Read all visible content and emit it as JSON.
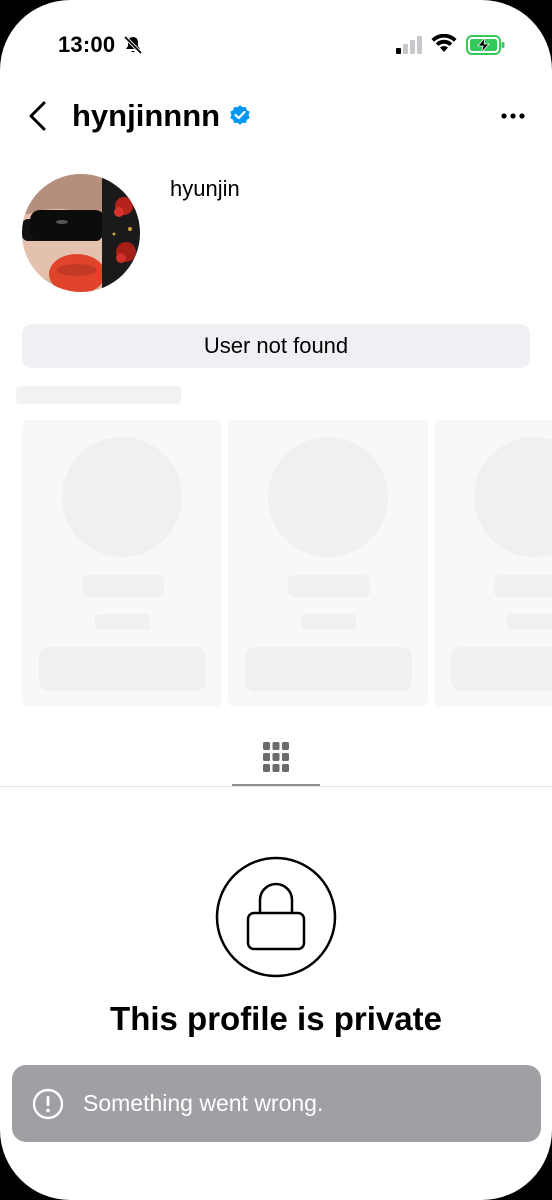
{
  "status_bar": {
    "time": "13:00",
    "icons": [
      "bell-slash-icon",
      "cellular-signal-icon",
      "wifi-icon",
      "battery-charging-icon"
    ],
    "battery_color": "#34c759"
  },
  "header": {
    "username": "hynjinnnn",
    "verified": true,
    "back_icon": "chevron-left-icon",
    "more_icon": "more-horizontal-icon"
  },
  "profile": {
    "display_name": "hyunjin",
    "avatar_icon": "profile-photo",
    "status_button_label": "User not found"
  },
  "suggestions": {
    "loading": true,
    "placeholder_cards": 3
  },
  "tabs": {
    "active": "grid-icon"
  },
  "private_notice": {
    "icon": "lock-icon",
    "title": "This profile is private"
  },
  "toast": {
    "icon": "exclamation-circle-icon",
    "message": "Something went wrong."
  },
  "colors": {
    "verified_blue": "#0095f6",
    "skeleton": "#eff0f2",
    "toast_bg": "#9ea0a3"
  }
}
